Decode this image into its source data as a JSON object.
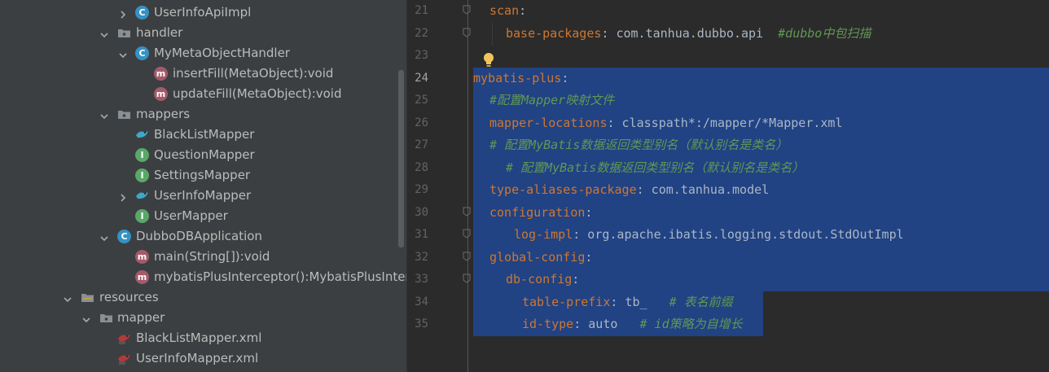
{
  "tree": {
    "rows": [
      {
        "label": "UserInfoApiImpl",
        "icon": "class-icon",
        "badge": "C",
        "arrow": "right"
      },
      {
        "label": "handler",
        "icon": "folder-icon",
        "badge": "",
        "arrow": "down"
      },
      {
        "label": "MyMetaObjectHandler",
        "icon": "class-icon",
        "badge": "C",
        "arrow": "down"
      },
      {
        "label": "insertFill(MetaObject):void",
        "icon": "method-icon",
        "badge": "m",
        "arrow": ""
      },
      {
        "label": "updateFill(MetaObject):void",
        "icon": "method-icon",
        "badge": "m",
        "arrow": ""
      },
      {
        "label": "mappers",
        "icon": "folder-icon",
        "badge": "",
        "arrow": "down"
      },
      {
        "label": "BlackListMapper",
        "icon": "mybatis-mapper-icon",
        "badge": "",
        "arrow": ""
      },
      {
        "label": "QuestionMapper",
        "icon": "interface-icon",
        "badge": "I",
        "arrow": ""
      },
      {
        "label": "SettingsMapper",
        "icon": "interface-icon",
        "badge": "I",
        "arrow": ""
      },
      {
        "label": "UserInfoMapper",
        "icon": "mybatis-mapper-icon",
        "badge": "",
        "arrow": "right"
      },
      {
        "label": "UserMapper",
        "icon": "interface-icon",
        "badge": "I",
        "arrow": ""
      },
      {
        "label": "DubboDBApplication",
        "icon": "spring-boot-class-icon",
        "badge": "C",
        "arrow": "down"
      },
      {
        "label": "main(String[]):void",
        "icon": "method-icon",
        "badge": "m",
        "arrow": ""
      },
      {
        "label": "mybatisPlusInterceptor():MybatisPlusInterceptor",
        "icon": "method-icon",
        "badge": "m",
        "arrow": ""
      },
      {
        "label": "resources",
        "icon": "resources-folder-icon",
        "badge": "",
        "arrow": "down"
      },
      {
        "label": "mapper",
        "icon": "folder-icon",
        "badge": "",
        "arrow": "down"
      },
      {
        "label": "BlackListMapper.xml",
        "icon": "mybatis-xml-icon",
        "badge": "",
        "arrow": ""
      },
      {
        "label": "UserInfoMapper.xml",
        "icon": "mybatis-xml-icon",
        "badge": "",
        "arrow": ""
      }
    ]
  },
  "editor": {
    "current_line": 24,
    "lines": [
      {
        "num": "21",
        "tokens": [
          {
            "t": "scan",
            "c": "k"
          },
          {
            "t": ":",
            "c": "p"
          }
        ]
      },
      {
        "num": "22",
        "tokens": [
          {
            "t": "base-packages",
            "c": "k"
          },
          {
            "t": ": com.tanhua.dubbo.api  ",
            "c": "v"
          },
          {
            "t": "#dubbo中包扫描",
            "c": "c"
          }
        ]
      },
      {
        "num": "23",
        "tokens": []
      },
      {
        "num": "24",
        "tokens": [
          {
            "t": "mybatis-plus",
            "c": "k"
          },
          {
            "t": ":",
            "c": "p"
          }
        ]
      },
      {
        "num": "25",
        "tokens": [
          {
            "t": "#配置Mapper映射文件",
            "c": "c"
          }
        ]
      },
      {
        "num": "26",
        "tokens": [
          {
            "t": "mapper-locations",
            "c": "k"
          },
          {
            "t": ": classpath*:/mapper/*Mapper.xml",
            "c": "v"
          }
        ]
      },
      {
        "num": "27",
        "tokens": [
          {
            "t": "# 配置MyBatis数据返回类型别名（默认别名是类名）",
            "c": "c"
          }
        ]
      },
      {
        "num": "28",
        "tokens": [
          {
            "t": "# 配置MyBatis数据返回类型别名（默认别名是类名）",
            "c": "c"
          }
        ]
      },
      {
        "num": "29",
        "tokens": [
          {
            "t": "type-aliases-package",
            "c": "k"
          },
          {
            "t": ": com.tanhua.model",
            "c": "v"
          }
        ]
      },
      {
        "num": "30",
        "tokens": [
          {
            "t": "configuration",
            "c": "k"
          },
          {
            "t": ":",
            "c": "p"
          }
        ]
      },
      {
        "num": "31",
        "tokens": [
          {
            "t": "log-impl",
            "c": "k"
          },
          {
            "t": ": org.apache.ibatis.logging.stdout.StdOutImpl",
            "c": "v"
          }
        ]
      },
      {
        "num": "32",
        "tokens": [
          {
            "t": "global-config",
            "c": "k"
          },
          {
            "t": ":",
            "c": "p"
          }
        ]
      },
      {
        "num": "33",
        "tokens": [
          {
            "t": "db-config",
            "c": "k"
          },
          {
            "t": ":",
            "c": "p"
          }
        ]
      },
      {
        "num": "34",
        "tokens": [
          {
            "t": "table-prefix",
            "c": "k"
          },
          {
            "t": ": tb_   ",
            "c": "v"
          },
          {
            "t": "# 表名前缀",
            "c": "c"
          }
        ]
      },
      {
        "num": "35",
        "tokens": [
          {
            "t": "id-type",
            "c": "k"
          },
          {
            "t": ": auto   ",
            "c": "v"
          },
          {
            "t": "# id策略为自增长",
            "c": "c"
          }
        ]
      }
    ]
  },
  "colors": {
    "tree_bg": "#3c3f41",
    "editor_bg": "#2b2b2b",
    "selection": "#214283",
    "yaml_key": "#cc7832",
    "yaml_value": "#a9b7c6",
    "yaml_comment": "#629755",
    "line_number": "#606366"
  }
}
